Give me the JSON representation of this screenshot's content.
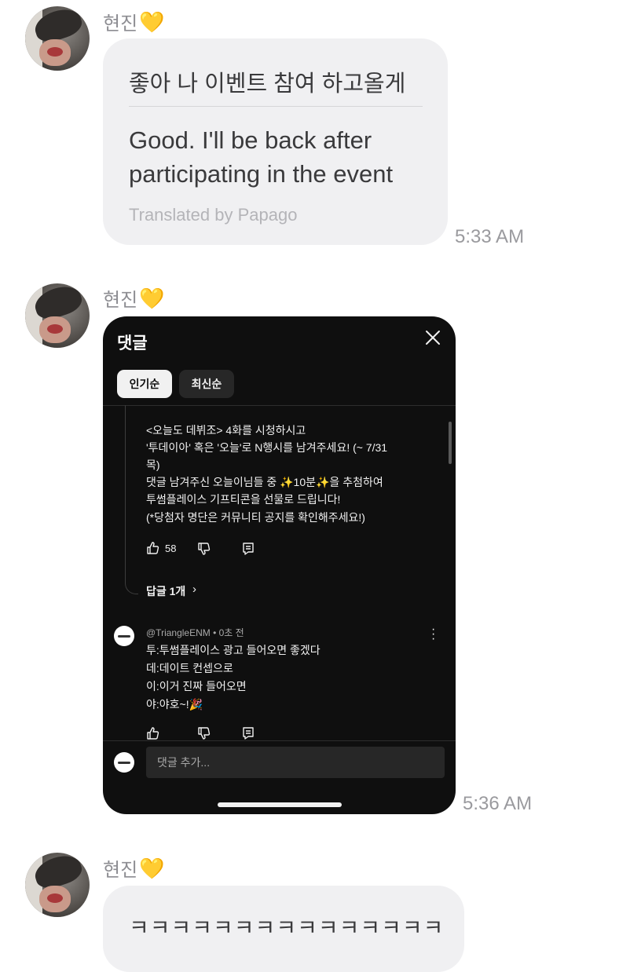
{
  "messages": [
    {
      "sender": "현진",
      "heart": "💛",
      "korean": "좋아 나 이벤트 참여 하고올게",
      "english": "Good. I'll be back after participating in the event",
      "translated_by": "Translated by Papago",
      "time": "5:33 AM"
    },
    {
      "sender": "현진",
      "heart": "💛",
      "time": "5:36 AM",
      "screenshot": {
        "title": "댓글",
        "close_icon": "close-icon",
        "tabs": [
          "인기순",
          "최신순"
        ],
        "active_tab": "인기순",
        "pinned_comment_lines": [
          "<오늘도 데뷔조> 4화를 시청하시고",
          "'투데이아' 혹은 '오늘'로 N행시를 남겨주세요! (~ 7/31",
          "목)",
          "댓글 남겨주신 오늘이님들 중 ✨10분✨을 추첨하여",
          "투썸플레이스 기프티콘을 선물로 드립니다!",
          "(*당첨자 명단은 커뮤니티 공지를 확인해주세요!)"
        ],
        "likes": "58",
        "replies_label": "답글 1개",
        "reply": {
          "handle": "@TriangleENM • 0초 전",
          "lines": [
            "투:투썸플레이스 광고 들어오면 좋겠다",
            "데:데이트 컨셉으로",
            "이:이거 진짜 들어오면",
            "야:야호~!🎉"
          ]
        },
        "add_comment_placeholder": "댓글 추가..."
      }
    },
    {
      "sender": "현진",
      "heart": "💛",
      "text": "ㅋㅋㅋㅋㅋㅋㅋㅋㅋㅋㅋㅋㅋㅋㅋ"
    }
  ]
}
